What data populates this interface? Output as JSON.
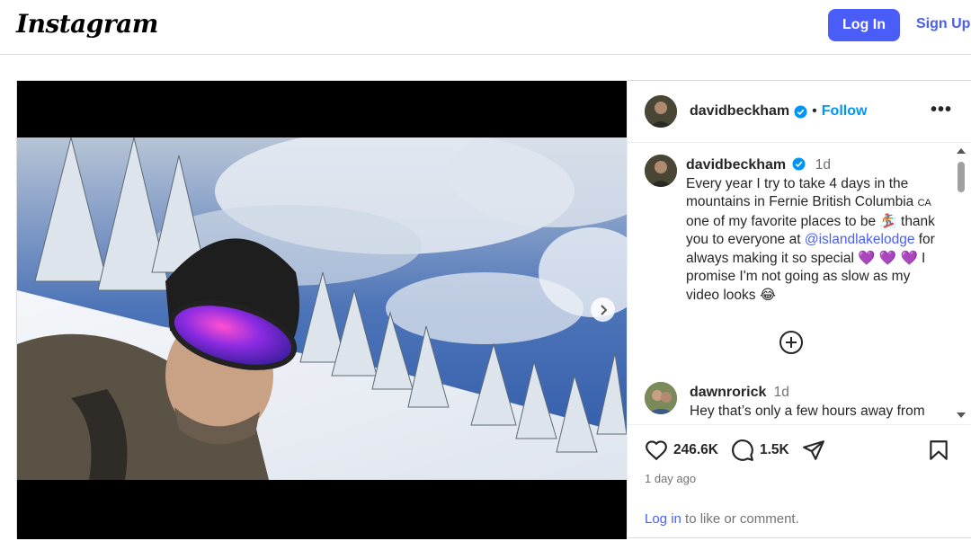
{
  "header": {
    "logo": "Instagram",
    "login_label": "Log In",
    "signup_label": "Sign Up"
  },
  "post": {
    "author": "davidbeckham",
    "follow_label": "Follow",
    "separator": "•",
    "more_label": "•••",
    "caption": {
      "username": "davidbeckham",
      "time": "1d",
      "line1": "Every year I try to take 4 days in the mountains in Fernie British Columbia ",
      "flag": "CA",
      "line2": " one of my favorite places to be 🏂",
      "line3": " thank you to everyone at ",
      "mention": "@islandlakelodge",
      "line4": " for always making it so special 💜 💜 💜 I promise I'm not going as slow as my video looks 😂"
    },
    "comment": {
      "username": "dawnrorick",
      "time": "1d",
      "text": "Hey that’s only a few hours away from"
    },
    "likes": "246.6K",
    "comments_count": "1.5K",
    "time_ago": "1 day ago",
    "login_link": "Log in",
    "login_rest": " to like or comment.",
    "carousel": {
      "slides": 14,
      "active_index": 0
    }
  },
  "colors": {
    "accent": "#4a5df9",
    "verified": "#0095f6",
    "muted": "#737373"
  }
}
